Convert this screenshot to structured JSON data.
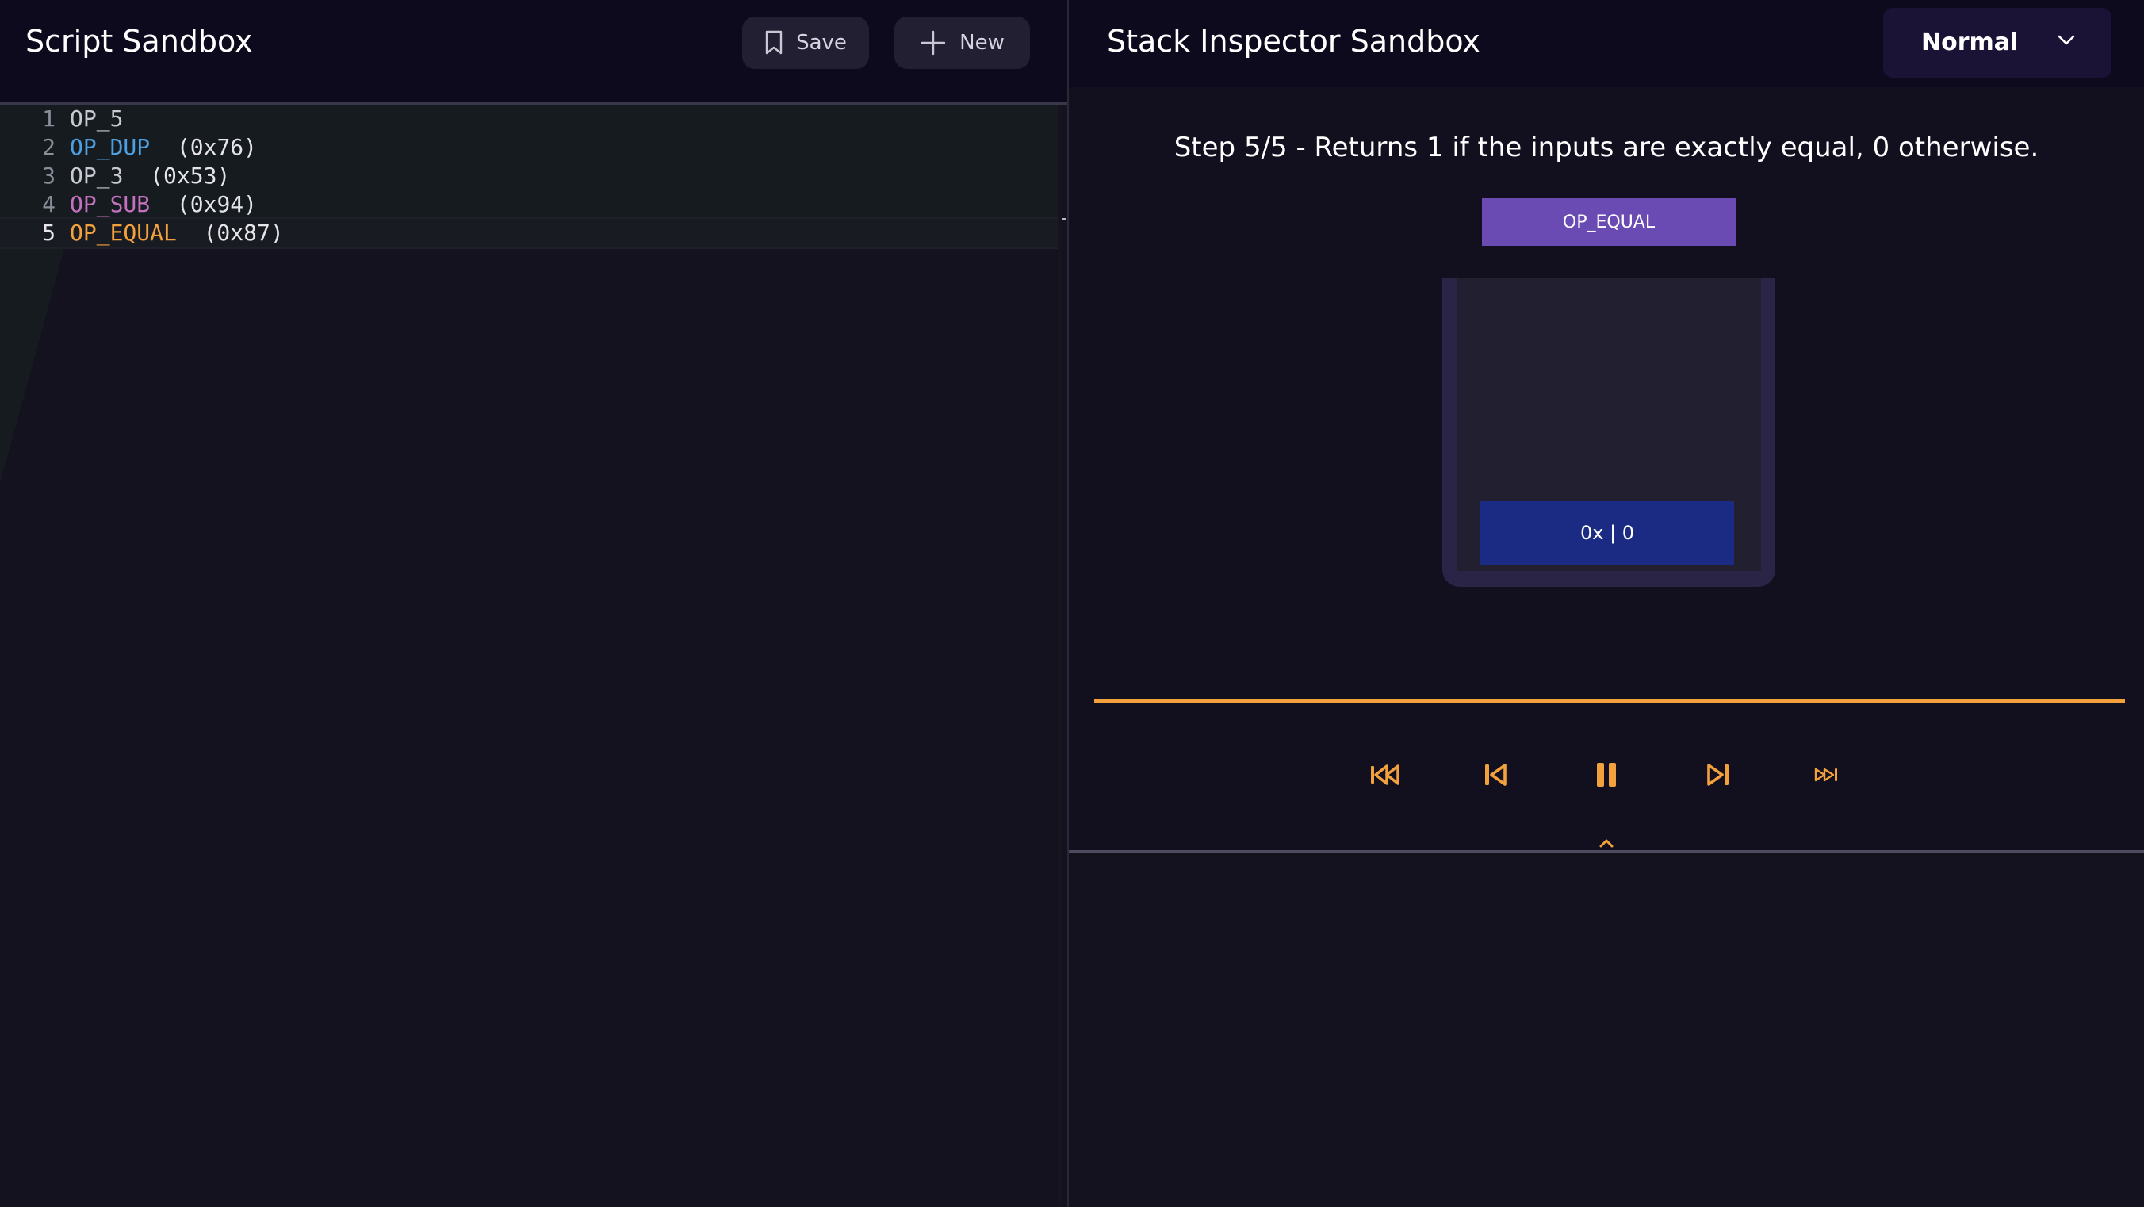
{
  "editor": {
    "title": "Script Sandbox",
    "save_label": "Save",
    "new_label": "New",
    "lines": [
      {
        "num": "1",
        "op": "OP_5",
        "hex": "",
        "color": "#c9c9d2"
      },
      {
        "num": "2",
        "op": "OP_DUP",
        "hex": "  (0x76)",
        "color": "#4d9fe0"
      },
      {
        "num": "3",
        "op": "OP_3",
        "hex": "  (0x53)",
        "color": "#c9c9d2"
      },
      {
        "num": "4",
        "op": "OP_SUB",
        "hex": "  (0x94)",
        "color": "#c472c0"
      },
      {
        "num": "5",
        "op": "OP_EQUAL",
        "hex": "  (0x87)",
        "color": "#f3a13d"
      }
    ],
    "active_line": 5
  },
  "inspector": {
    "title": "Stack Inspector Sandbox",
    "speed": "Normal",
    "step_description": "Step 5/5 - Returns 1 if the inputs are exactly equal, 0 otherwise.",
    "current_op": "OP_EQUAL",
    "stack_items": [
      "0x | 0"
    ],
    "progress_percent": 100
  },
  "controls": {
    "icons": [
      "jump-to-start-icon",
      "step-back-icon",
      "pause-icon",
      "step-forward-icon",
      "jump-to-end-icon"
    ]
  },
  "colors": {
    "accent": "#f3a13d",
    "op_chip": "#6a4bb3",
    "stack_item": "#1b2a82",
    "header_bg": "#0d0a1d"
  }
}
